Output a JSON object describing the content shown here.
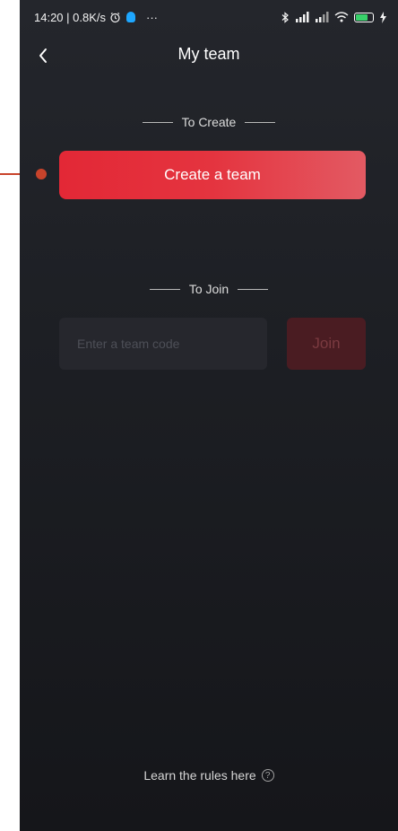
{
  "status_bar": {
    "time_speed": "14:20 | 0.8K/s",
    "more": "···",
    "icons": [
      "alarm-icon",
      "notification-icon",
      "bluetooth-icon",
      "signal-icon",
      "signal-icon",
      "wifi-icon",
      "battery-icon",
      "charging-icon"
    ],
    "battery_level": "89"
  },
  "header": {
    "title": "My team",
    "back_icon": "chevron-left-icon"
  },
  "create_section": {
    "label": "To Create",
    "button_label": "Create a team"
  },
  "join_section": {
    "label": "To Join",
    "input_placeholder": "Enter a team code",
    "input_value": "",
    "button_label": "Join"
  },
  "footer": {
    "rules_text": "Learn the rules here",
    "help_icon": "question-circle-icon"
  },
  "colors": {
    "accent": "#e4343f",
    "background": "#1d1f24",
    "annotation": "#c8432b"
  }
}
